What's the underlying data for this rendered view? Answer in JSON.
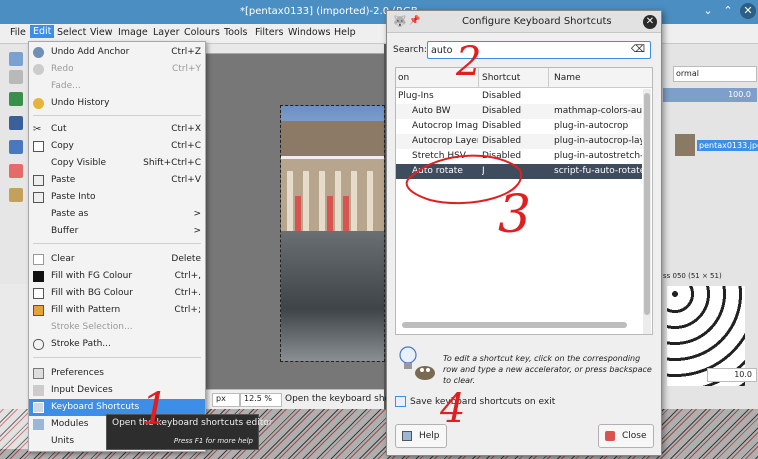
{
  "window": {
    "title": "*[pentax0133] (imported)-2.0 (RGB"
  },
  "menubar": [
    "File",
    "Edit",
    "Select",
    "View",
    "Image",
    "Layer",
    "Colours",
    "Tools",
    "Filters",
    "Windows",
    "Help"
  ],
  "edit_menu": [
    {
      "label": "Undo Add Anchor",
      "shortcut": "Ctrl+Z",
      "disabled": false
    },
    {
      "label": "Redo",
      "shortcut": "Ctrl+Y",
      "disabled": true
    },
    {
      "label": "Fade...",
      "shortcut": "",
      "disabled": true
    },
    {
      "label": "Undo History",
      "shortcut": "",
      "disabled": false
    },
    {
      "label": "Cut",
      "shortcut": "Ctrl+X",
      "disabled": false
    },
    {
      "label": "Copy",
      "shortcut": "Ctrl+C",
      "disabled": false
    },
    {
      "label": "Copy Visible",
      "shortcut": "Shift+Ctrl+C",
      "disabled": false
    },
    {
      "label": "Paste",
      "shortcut": "Ctrl+V",
      "disabled": false
    },
    {
      "label": "Paste Into",
      "shortcut": "",
      "disabled": false
    },
    {
      "label": "Paste as",
      "shortcut": ">",
      "disabled": false
    },
    {
      "label": "Buffer",
      "shortcut": ">",
      "disabled": false
    },
    {
      "label": "Clear",
      "shortcut": "Delete",
      "disabled": false
    },
    {
      "label": "Fill with FG Colour",
      "shortcut": "Ctrl+,",
      "disabled": false
    },
    {
      "label": "Fill with BG Colour",
      "shortcut": "Ctrl+.",
      "disabled": false
    },
    {
      "label": "Fill with Pattern",
      "shortcut": "Ctrl+;",
      "disabled": false
    },
    {
      "label": "Stroke Selection...",
      "shortcut": "",
      "disabled": true
    },
    {
      "label": "Stroke Path...",
      "shortcut": "",
      "disabled": false
    },
    {
      "label": "Preferences",
      "shortcut": "",
      "disabled": false
    },
    {
      "label": "Input Devices",
      "shortcut": "",
      "disabled": false
    },
    {
      "label": "Keyboard Shortcuts",
      "shortcut": "",
      "disabled": false
    },
    {
      "label": "Modules",
      "shortcut": "",
      "disabled": false
    },
    {
      "label": "Units",
      "shortcut": "",
      "disabled": false
    }
  ],
  "tooltip": {
    "text": "Open the keyboard shortcuts editor",
    "help": "Press F1 for more help"
  },
  "statusbar": {
    "unit": "px",
    "zoom": "12.5 %",
    "message": "Open the keyboard shor"
  },
  "dialog": {
    "title": "Configure Keyboard Shortcuts",
    "search_label": "Search:",
    "search_value": "auto",
    "columns": [
      "on",
      "Shortcut",
      "Name"
    ],
    "rows": [
      {
        "action": "Plug-Ins",
        "shortcut": "Disabled",
        "name": ""
      },
      {
        "action": "Auto BW",
        "shortcut": "Disabled",
        "name": "mathmap-colors-auto-"
      },
      {
        "action": "Autocrop Image",
        "shortcut": "Disabled",
        "name": "plug-in-autocrop"
      },
      {
        "action": "Autocrop Layer",
        "shortcut": "Disabled",
        "name": "plug-in-autocrop-layer"
      },
      {
        "action": "Stretch HSV",
        "shortcut": "Disabled",
        "name": "plug-in-autostretch-hs"
      },
      {
        "action": "Auto rotate",
        "shortcut": "J",
        "name": "script-fu-auto-rotate"
      }
    ],
    "hint": "To edit a shortcut key, click on the corresponding row and type a new accelerator, or press backspace to clear.",
    "save_label": "Save keyboard shortcuts on exit",
    "help_label": "Help",
    "close_label": "Close"
  },
  "dock": {
    "mode": "ormal",
    "opacity": "100.0",
    "layer_name": "pentax0133.jpg",
    "brush": "ss 050 (51 × 51)",
    "spacing": "10.0"
  },
  "annotations": [
    "1",
    "2",
    "3",
    "4"
  ],
  "colors": {
    "selection": "#3d8ee6",
    "row_selected": "#3e4c5e",
    "titlebar": "#4b8ec1",
    "annotation": "#e02020"
  }
}
